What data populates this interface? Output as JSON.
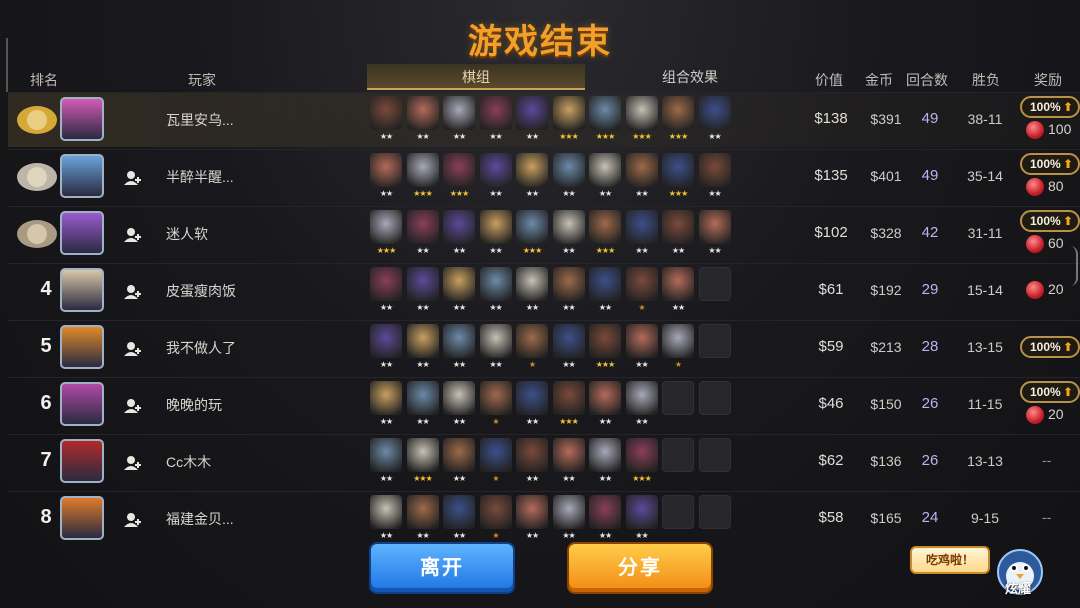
{
  "title": "游戏结束",
  "header": {
    "rank": "排名",
    "player": "玩家",
    "tab_board": "棋组",
    "tab_synergy": "组合效果",
    "value": "价值",
    "gold": "金币",
    "rounds": "回合数",
    "record": "胜负",
    "reward": "奖励"
  },
  "colors": {
    "title": "#f3a02a",
    "rounds": "#b7b6f0",
    "leave_button": "#1d74e3",
    "share_button": "#f28a12",
    "star_gold": "#f1c232",
    "star_silver": "#e6e6e6",
    "star_bronze": "#d08a27"
  },
  "players": [
    {
      "rank": "1",
      "medal": "gold-medal-icon",
      "name": "瓦里安乌...",
      "is_me": true,
      "pieces": [
        2,
        2,
        2,
        2,
        2,
        3,
        3,
        3,
        3,
        2
      ],
      "value": "$138",
      "gold": "$391",
      "rounds": "49",
      "record": "38-11",
      "reward_pct": "100%",
      "reward_amount": "100"
    },
    {
      "rank": "2",
      "medal": "silver-medal-icon",
      "name": "半醉半醒...",
      "is_me": false,
      "pieces": [
        2,
        3,
        3,
        2,
        2,
        2,
        2,
        2,
        3,
        2
      ],
      "value": "$135",
      "gold": "$401",
      "rounds": "49",
      "record": "35-14",
      "reward_pct": "100%",
      "reward_amount": "80"
    },
    {
      "rank": "3",
      "medal": "bronze-medal-icon",
      "name": "迷人软",
      "is_me": false,
      "pieces": [
        3,
        2,
        2,
        2,
        3,
        2,
        3,
        2,
        2,
        2
      ],
      "value": "$102",
      "gold": "$328",
      "rounds": "42",
      "record": "31-11",
      "reward_pct": "100%",
      "reward_amount": "60"
    },
    {
      "rank": "4",
      "medal": "",
      "name": "皮蛋瘦肉饭",
      "is_me": false,
      "pieces": [
        2,
        2,
        2,
        2,
        2,
        2,
        2,
        1,
        2,
        0
      ],
      "value": "$61",
      "gold": "$192",
      "rounds": "29",
      "record": "15-14",
      "reward_pct": "",
      "reward_amount": "20"
    },
    {
      "rank": "5",
      "medal": "",
      "name": "我不做人了",
      "is_me": false,
      "pieces": [
        2,
        2,
        2,
        2,
        1,
        2,
        3,
        2,
        1,
        0
      ],
      "value": "$59",
      "gold": "$213",
      "rounds": "28",
      "record": "13-15",
      "reward_pct": "100%",
      "reward_amount": ""
    },
    {
      "rank": "6",
      "medal": "",
      "name": "晚晚的玩",
      "is_me": false,
      "pieces": [
        2,
        2,
        2,
        1,
        2,
        3,
        2,
        2,
        0,
        0
      ],
      "value": "$46",
      "gold": "$150",
      "rounds": "26",
      "record": "11-15",
      "reward_pct": "100%",
      "reward_amount": "20"
    },
    {
      "rank": "7",
      "medal": "",
      "name": "Cc木木",
      "is_me": false,
      "pieces": [
        2,
        3,
        2,
        1,
        2,
        2,
        2,
        3,
        0,
        0
      ],
      "value": "$62",
      "gold": "$136",
      "rounds": "26",
      "record": "13-13",
      "reward_pct": "",
      "reward_amount": "",
      "reward_text": "--"
    },
    {
      "rank": "8",
      "medal": "",
      "name": "福建金贝...",
      "is_me": false,
      "pieces": [
        2,
        2,
        2,
        1,
        2,
        2,
        2,
        2,
        0,
        0
      ],
      "value": "$58",
      "gold": "$165",
      "rounds": "24",
      "record": "9-15",
      "reward_pct": "",
      "reward_amount": "",
      "reward_text": "--"
    }
  ],
  "buttons": {
    "leave": "离开",
    "share": "分享"
  },
  "bubble": "吃鸡啦！",
  "brag": "炫耀"
}
